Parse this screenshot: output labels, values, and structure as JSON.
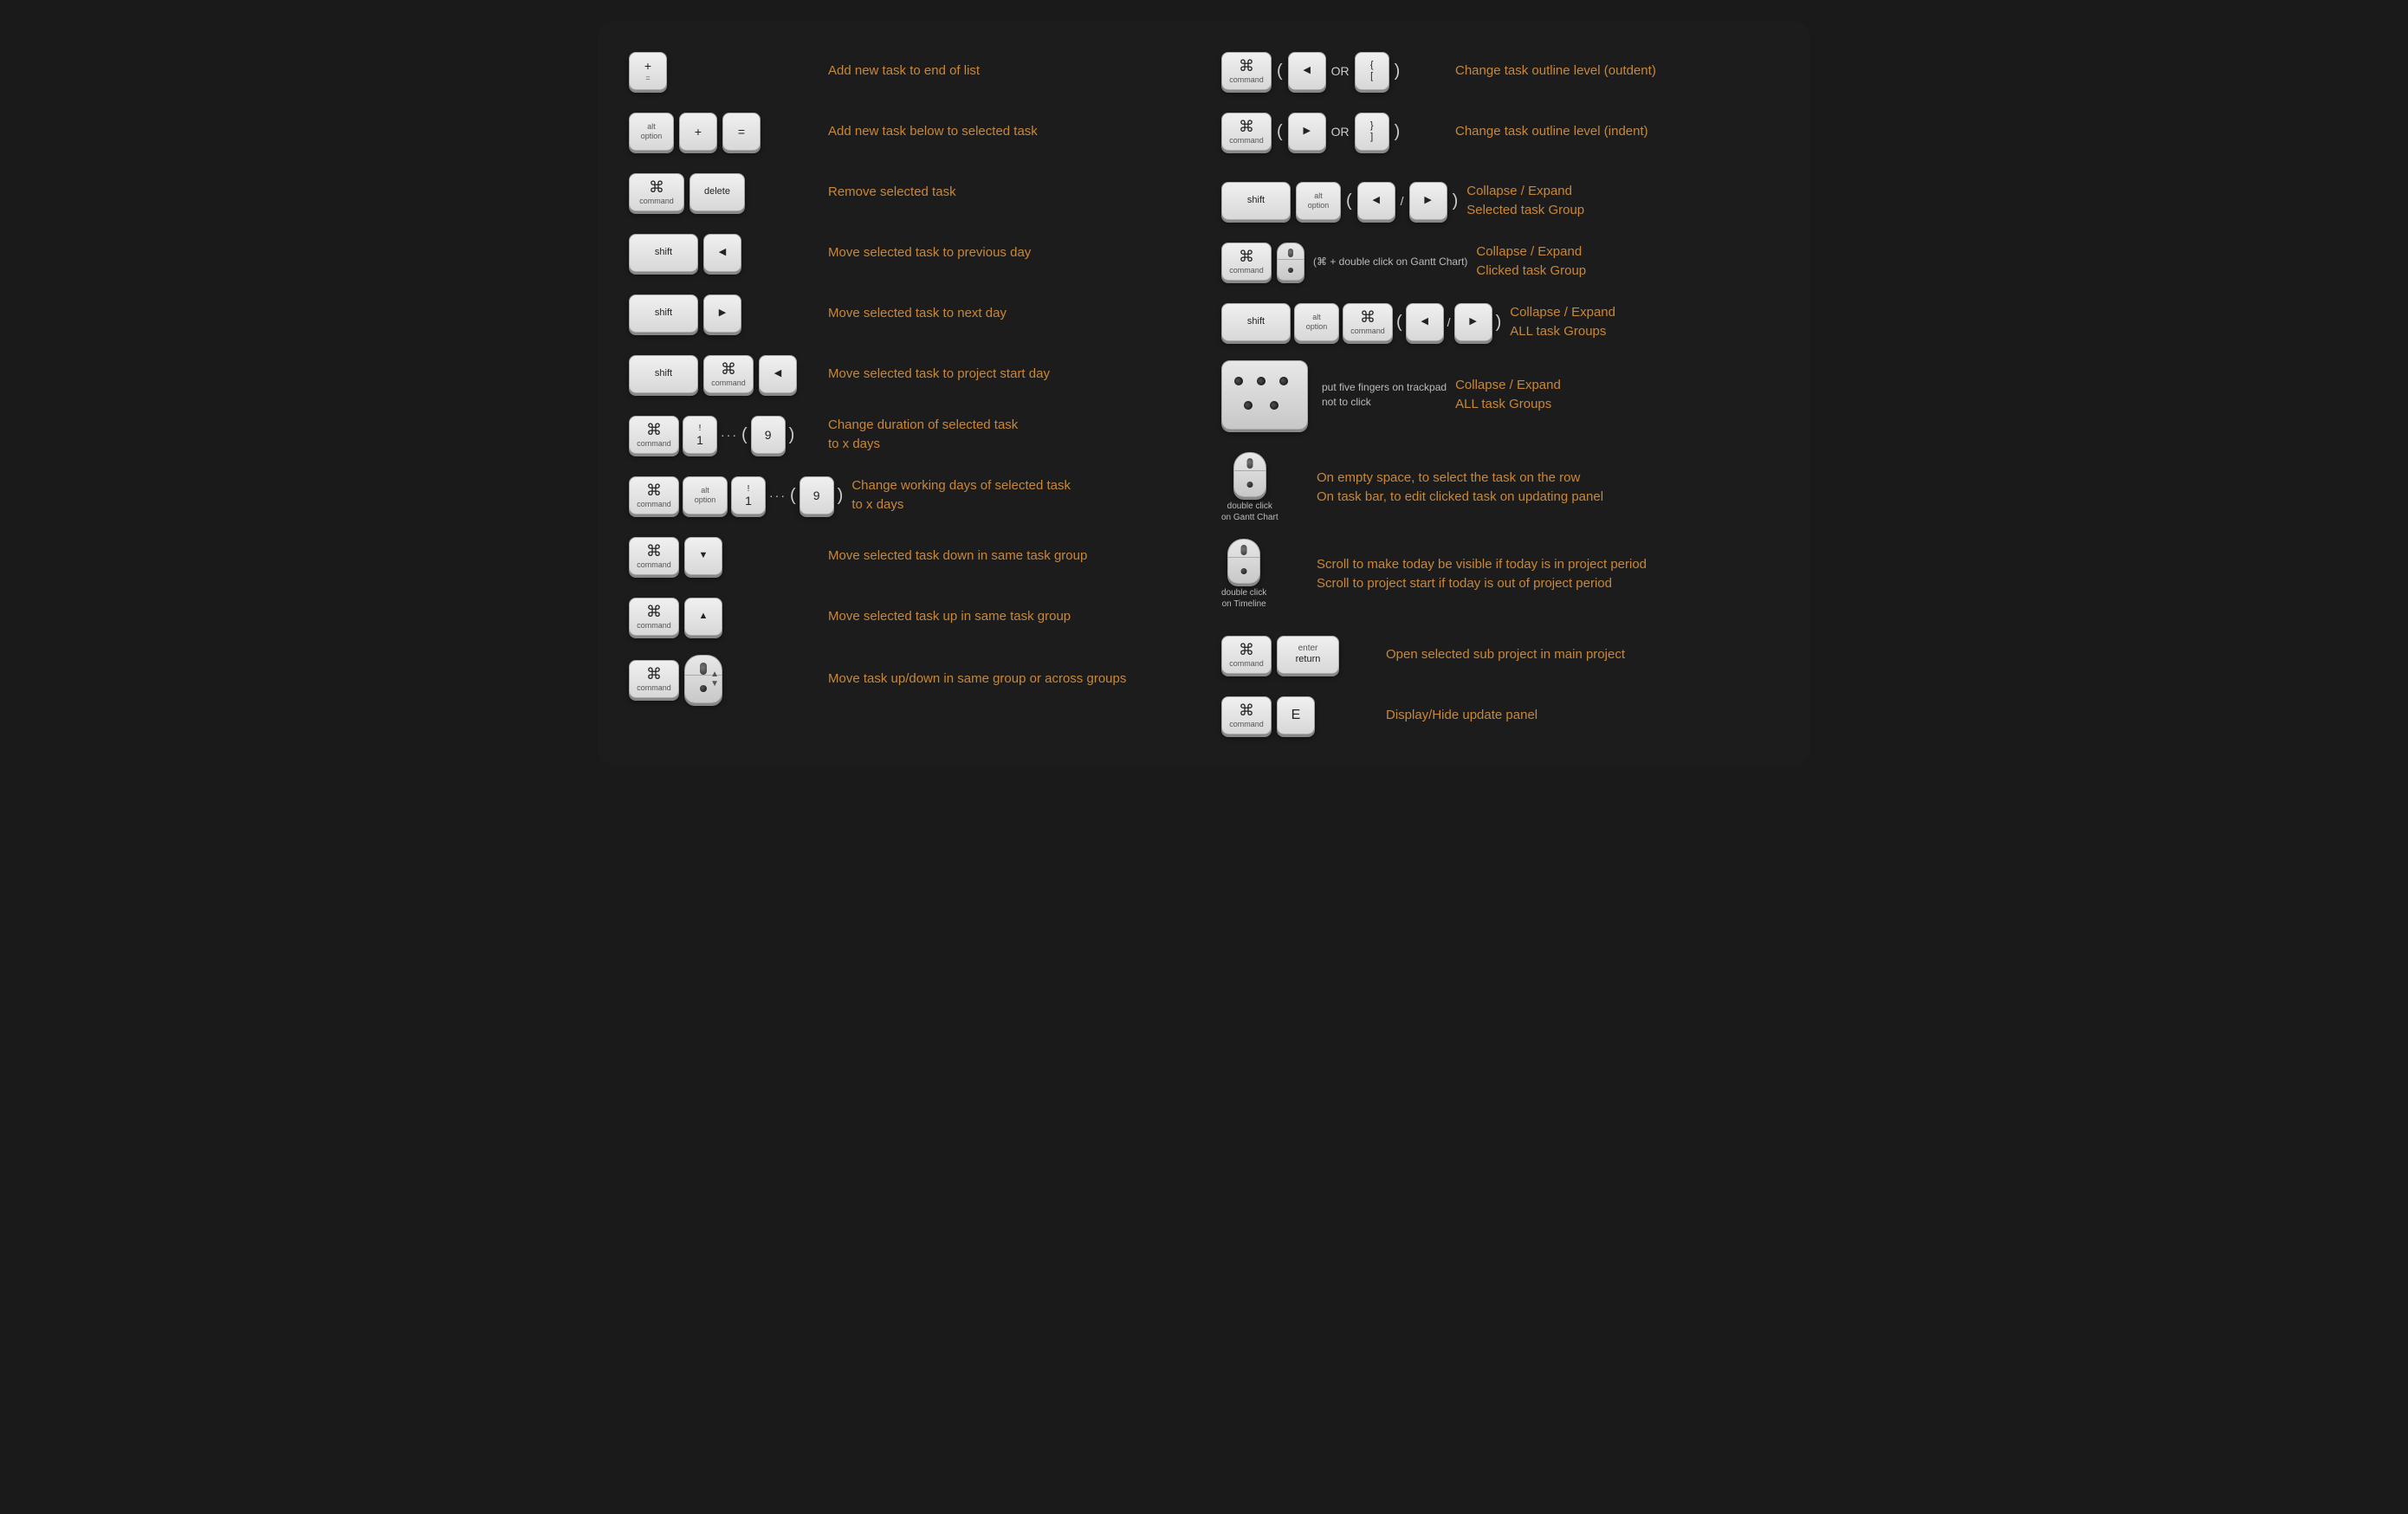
{
  "left_shortcuts": [
    {
      "id": "add-new-end",
      "keys": [
        {
          "symbol": "+",
          "label": "="
        },
        {
          "symbol": "=",
          "label": ""
        }
      ],
      "description": "Add new task to end of list"
    },
    {
      "id": "add-new-below",
      "keys": [
        {
          "top": "alt",
          "label": "option",
          "symbol": ""
        },
        {
          "symbol": "+",
          "label": ""
        },
        {
          "symbol": "=",
          "label": ""
        }
      ],
      "description": "Add new task below to selected task"
    },
    {
      "id": "remove-task",
      "keys": [
        {
          "symbol": "⌘",
          "label": "command"
        },
        {
          "symbol": "delete",
          "label": ""
        }
      ],
      "description": "Remove selected task"
    },
    {
      "id": "move-prev-day",
      "keys": [
        {
          "symbol": "shift",
          "label": "",
          "wide": true
        },
        {
          "symbol": "◀",
          "label": ""
        }
      ],
      "description": "Move selected task to previous day"
    },
    {
      "id": "move-next-day",
      "keys": [
        {
          "symbol": "shift",
          "label": "",
          "wide": true
        },
        {
          "symbol": "▶",
          "label": ""
        }
      ],
      "description": "Move selected task to next day"
    },
    {
      "id": "move-project-start",
      "keys": [
        {
          "symbol": "shift",
          "label": "",
          "wide": true
        },
        {
          "symbol": "⌘",
          "label": "command"
        },
        {
          "symbol": "◀",
          "label": ""
        }
      ],
      "description": "Move selected task to project start day"
    },
    {
      "id": "change-duration",
      "keys": [
        {
          "symbol": "⌘",
          "label": "command"
        },
        {
          "symbol": "!",
          "sub": "1",
          "label": ""
        },
        "dots",
        {
          "paren": "("
        },
        {
          "symbol": "9",
          "label": ""
        },
        {
          "paren": ")"
        }
      ],
      "description": "Change duration of selected task\nto x days"
    },
    {
      "id": "change-working-days",
      "keys": [
        {
          "symbol": "⌘",
          "label": "command"
        },
        {
          "top": "alt",
          "label": "option"
        },
        {
          "symbol": "!",
          "sub": "1",
          "label": ""
        },
        "dots",
        {
          "paren": "("
        },
        {
          "symbol": "9",
          "label": ""
        },
        {
          "paren": ")"
        }
      ],
      "description": "Change working days of selected task\nto x days"
    },
    {
      "id": "move-down",
      "keys": [
        {
          "symbol": "⌘",
          "label": "command"
        },
        {
          "symbol": "▼",
          "label": ""
        }
      ],
      "description": "Move selected task down in same task group"
    },
    {
      "id": "move-up",
      "keys": [
        {
          "symbol": "⌘",
          "label": "command"
        },
        {
          "symbol": "▲",
          "label": ""
        }
      ],
      "description": "Move selected task up in same task group"
    },
    {
      "id": "move-updown-drag",
      "keys": "mouse-drag",
      "description": "Move task up/down in same group or across groups"
    }
  ],
  "right_shortcuts": [
    {
      "id": "outdent",
      "keys": [
        {
          "symbol": "⌘",
          "label": "command"
        },
        {
          "paren": "("
        },
        {
          "symbol": "◀",
          "label": ""
        },
        {
          "operator": "OR"
        },
        {
          "symbol": "{",
          "sub": "[",
          "label": ""
        },
        {
          "paren": ")"
        }
      ],
      "description": "Change task outline level (outdent)"
    },
    {
      "id": "indent",
      "keys": [
        {
          "symbol": "⌘",
          "label": "command"
        },
        {
          "paren": "("
        },
        {
          "symbol": "▶",
          "label": ""
        },
        {
          "operator": "OR"
        },
        {
          "symbol": "}",
          "sub": "]",
          "label": ""
        },
        {
          "paren": ")"
        }
      ],
      "description": "Change task outline level (indent)"
    },
    {
      "id": "collapse-selected-group",
      "keys": [
        {
          "symbol": "shift",
          "label": "",
          "wide": true
        },
        {
          "top": "alt",
          "label": "option"
        },
        {
          "paren": "("
        },
        {
          "symbol": "◀",
          "label": ""
        },
        {
          "operator": "/"
        },
        {
          "symbol": "▶",
          "label": ""
        },
        {
          "paren": ")"
        }
      ],
      "description": "Collapse / Expand\nSelected task Group"
    },
    {
      "id": "collapse-clicked-group",
      "keys": [
        {
          "symbol": "⌘",
          "label": "command"
        },
        "mouse-click",
        {
          "parenlabel": "(⌘ + double click on Gantt Chart)"
        }
      ],
      "description": "Collapse / Expand\nClicked task Group"
    },
    {
      "id": "collapse-all-groups",
      "keys": [
        {
          "symbol": "shift",
          "label": "",
          "wide": true
        },
        {
          "top": "alt",
          "label": "option"
        },
        {
          "symbol": "⌘",
          "label": "command"
        },
        {
          "paren": "("
        },
        {
          "symbol": "◀",
          "label": ""
        },
        {
          "operator": "/"
        },
        {
          "symbol": "▶",
          "label": ""
        },
        {
          "paren": ")"
        }
      ],
      "description": "Collapse / Expand\nALL task Groups"
    },
    {
      "id": "collapse-trackpad",
      "keys": "trackpad",
      "description": "Collapse / Expand\nALL task Groups",
      "trackpad_label": "put five fingers on trackpad\nnot to click"
    },
    {
      "id": "double-click-gantt",
      "keys": "mouse-gantt",
      "mouse_label": "double click\non Gantt Chart",
      "description": "On empty space, to select the task on the row\nOn task bar,  to edit clicked task on updating panel"
    },
    {
      "id": "double-click-timeline",
      "keys": "mouse-timeline",
      "mouse_label": "double click\non Timeline",
      "description": "Scroll to make today be visible if today is in project period\nScroll to project start if today is out of project period"
    },
    {
      "id": "open-sub-project",
      "keys": [
        {
          "symbol": "⌘",
          "label": "command"
        },
        {
          "symbol": "enter",
          "sub": "return",
          "label": "",
          "wide": true
        }
      ],
      "description": "Open selected sub project in main project"
    },
    {
      "id": "display-hide-panel",
      "keys": [
        {
          "symbol": "⌘",
          "label": "command"
        },
        {
          "symbol": "E",
          "label": ""
        }
      ],
      "description": "Display/Hide update panel"
    }
  ],
  "labels": {
    "alt_option": "alt\noption",
    "shift": "shift",
    "command": "command",
    "delete": "delete",
    "enter_return": "enter\nreturn"
  }
}
